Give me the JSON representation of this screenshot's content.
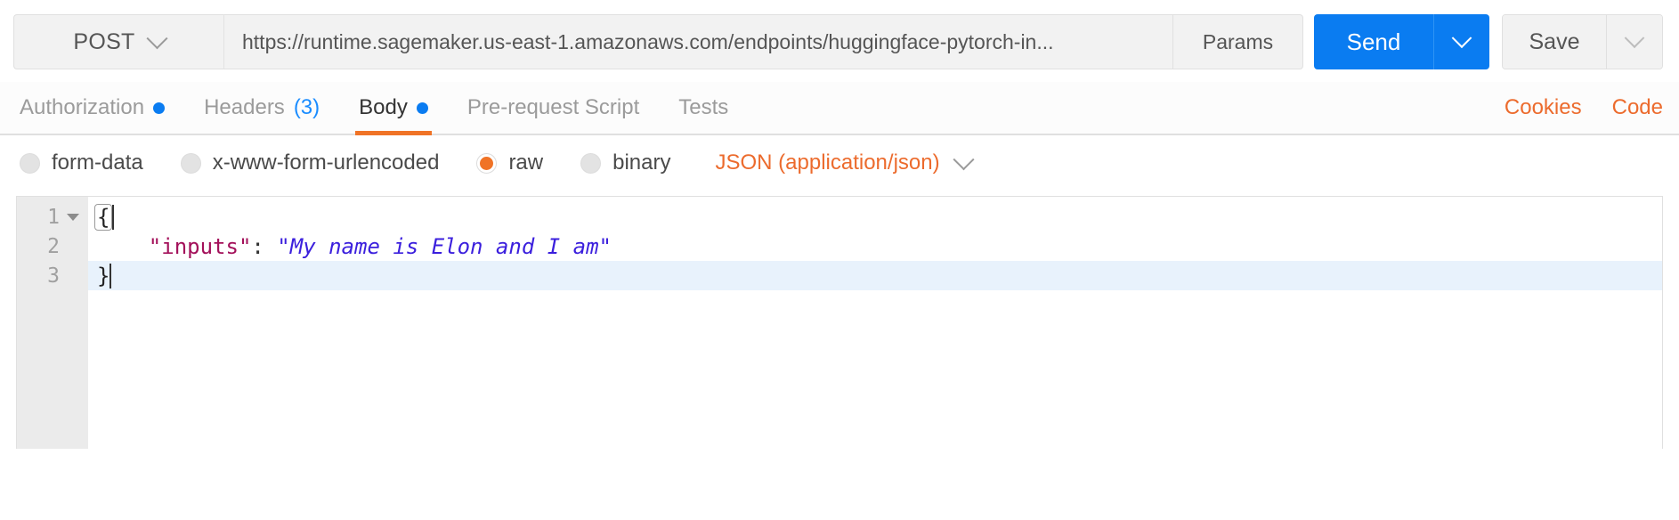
{
  "request_bar": {
    "method": "POST",
    "method_caret_icon": "chevron-down-icon",
    "url": "https://runtime.sagemaker.us-east-1.amazonaws.com/endpoints/huggingface-pytorch-in...",
    "url_placeholder": "Enter request URL",
    "params_label": "Params",
    "send_label": "Send",
    "send_caret_icon": "chevron-down-icon",
    "save_label": "Save",
    "save_caret_icon": "chevron-down-icon",
    "accent_blue": "#0a7cf1"
  },
  "tabs": {
    "items": [
      {
        "label": "Authorization",
        "badge_dot": true,
        "count": "",
        "active": false
      },
      {
        "label": "Headers",
        "badge_dot": false,
        "count": "(3)",
        "active": false
      },
      {
        "label": "Body",
        "badge_dot": true,
        "count": "",
        "active": true
      },
      {
        "label": "Pre-request Script",
        "badge_dot": false,
        "count": "",
        "active": false
      },
      {
        "label": "Tests",
        "badge_dot": false,
        "count": "",
        "active": false
      }
    ],
    "cookies_label": "Cookies",
    "code_label": "Code",
    "active_underline_color": "#f07326",
    "dot_color": "#0a7cf1",
    "link_color": "#ec6b2d"
  },
  "body_type": {
    "options": [
      {
        "label": "form-data",
        "selected": false
      },
      {
        "label": "x-www-form-urlencoded",
        "selected": false
      },
      {
        "label": "raw",
        "selected": true
      },
      {
        "label": "binary",
        "selected": false
      }
    ],
    "format": "JSON (application/json)",
    "format_caret_icon": "chevron-down-icon",
    "selected_color": "#f07326"
  },
  "editor": {
    "lines": [
      {
        "number": "1",
        "foldable": true,
        "active": false,
        "tokens": [
          {
            "type": "brace-match",
            "text": "{"
          }
        ]
      },
      {
        "number": "2",
        "foldable": false,
        "active": false,
        "tokens": [
          {
            "type": "key",
            "text": "    \"inputs\""
          },
          {
            "type": "punct",
            "text": ": "
          },
          {
            "type": "str",
            "text": "\"My name is Elon and I am\""
          }
        ]
      },
      {
        "number": "3",
        "foldable": false,
        "active": true,
        "tokens": [
          {
            "type": "brace",
            "text": "}"
          },
          {
            "type": "caret",
            "text": ""
          }
        ]
      }
    ],
    "active_line_color": "#e8f2fc",
    "key_color": "#a3105a",
    "string_color": "#3b1fdd"
  }
}
